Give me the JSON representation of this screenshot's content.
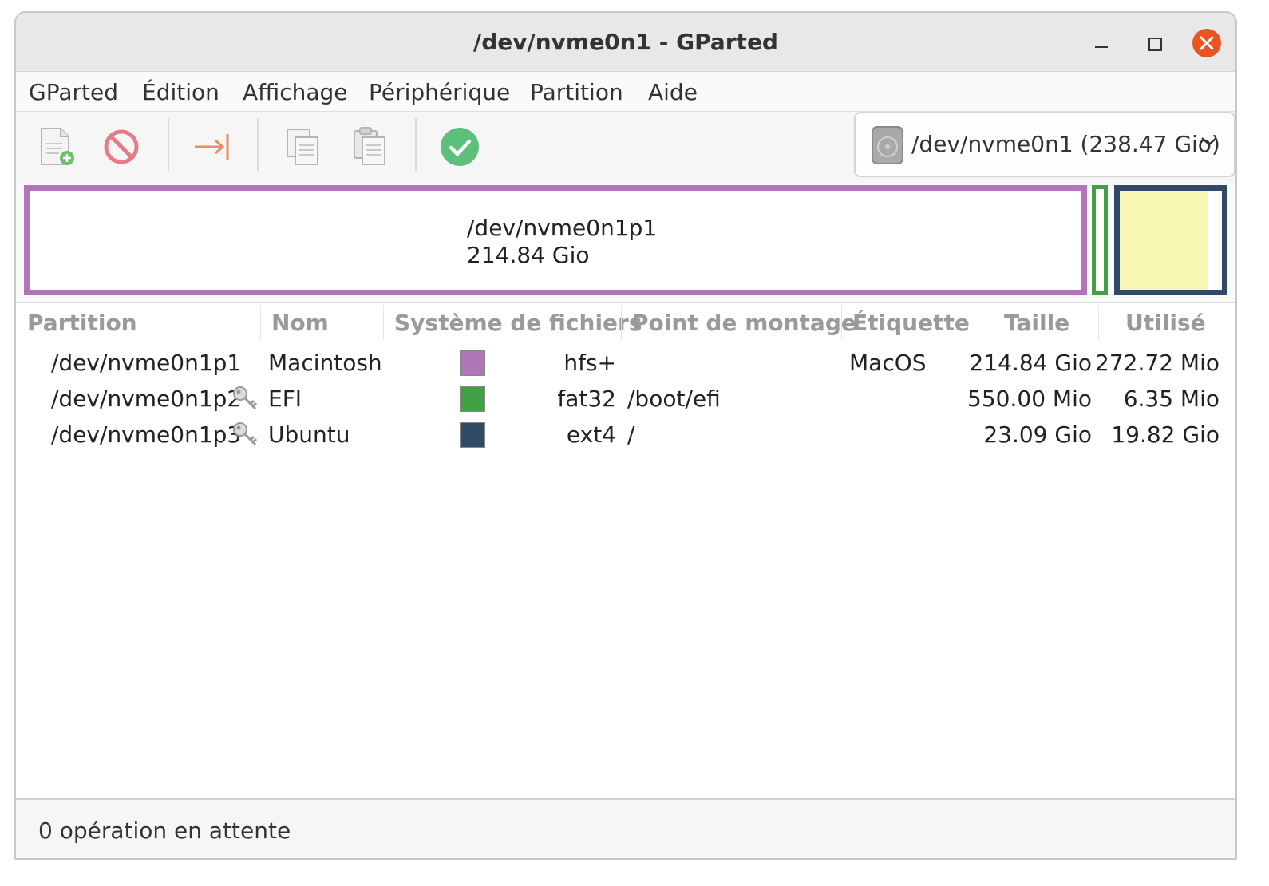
{
  "window": {
    "title": "/dev/nvme0n1 - GParted"
  },
  "menu": [
    "GParted",
    "Édition",
    "Affichage",
    "Périphérique",
    "Partition",
    "Aide"
  ],
  "toolbar": {
    "icons": [
      "new-partition-icon",
      "delete-icon",
      "resize-move-icon",
      "copy-icon",
      "paste-icon",
      "apply-icon"
    ],
    "device_selector": "/dev/nvme0n1 (238.47 Gio)"
  },
  "disk_map": {
    "selected_name": "/dev/nvme0n1p1",
    "selected_size": "214.84 Gio",
    "p3_used_fraction": 0.857
  },
  "columns": [
    "Partition",
    "Nom",
    "Système de fichiers",
    "Point de montage",
    "Étiquette",
    "Taille",
    "Utilisé"
  ],
  "partitions": [
    {
      "partition": "/dev/nvme0n1p1",
      "name": "Macintosh",
      "fs": "hfs+",
      "fs_color": "#b176b8",
      "mount": "",
      "label": "MacOS",
      "size": "214.84 Gio",
      "used": "272.72 Mio",
      "locked": false
    },
    {
      "partition": "/dev/nvme0n1p2",
      "name": "EFI",
      "fs": "fat32",
      "fs_color": "#41a043",
      "mount": "/boot/efi",
      "label": "",
      "size": "550.00 Mio",
      "used": "6.35 Mio",
      "locked": true
    },
    {
      "partition": "/dev/nvme0n1p3",
      "name": "Ubuntu",
      "fs": "ext4",
      "fs_color": "#304a65",
      "mount": "/",
      "label": "",
      "size": "23.09 Gio",
      "used": "19.82 Gio",
      "locked": true
    }
  ],
  "status": {
    "text": "0 opération en attente"
  },
  "colors": {
    "close_button": "#e95420",
    "hfs": "#b176b8",
    "fat32": "#41a043",
    "ext4": "#304a65",
    "used_space": "#f7f6b3"
  }
}
